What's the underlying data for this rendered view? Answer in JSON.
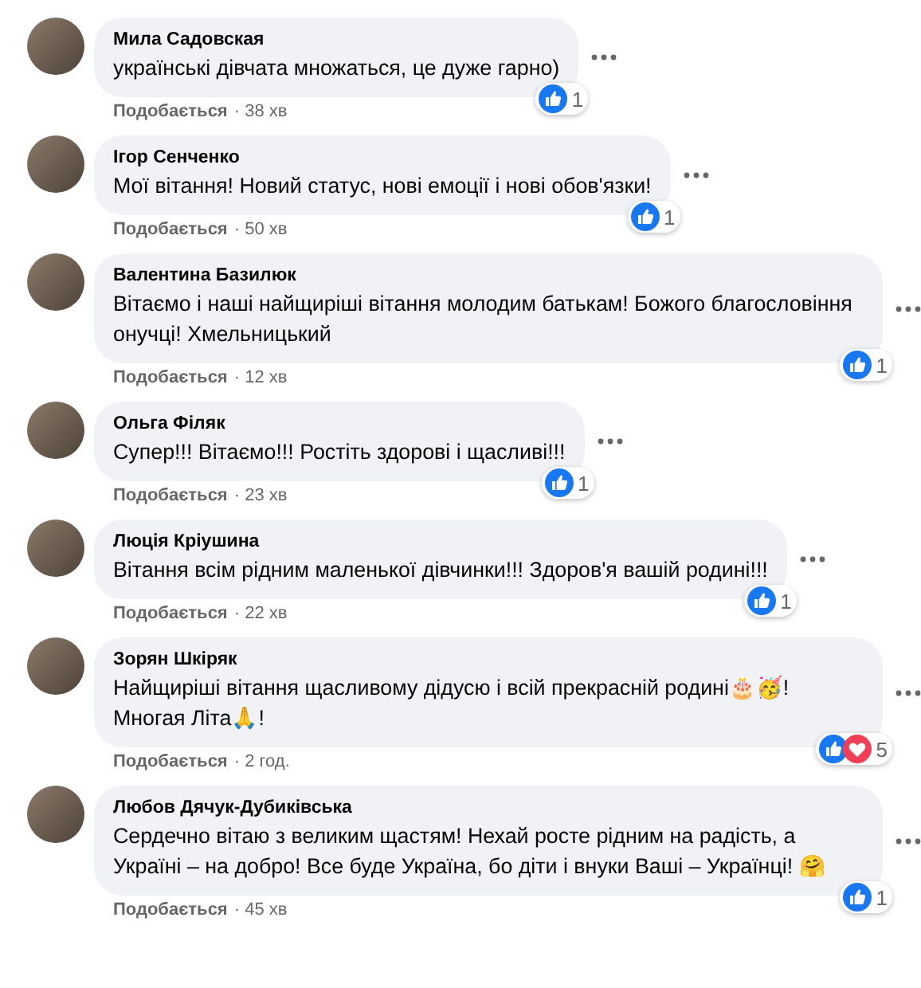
{
  "comments": [
    {
      "author": "Мила Садовская",
      "message": "українські дівчата множаться, це дуже гарно)",
      "reactions": [
        {
          "kind": "like"
        }
      ],
      "reaction_count": "1",
      "like_action": "Подобається",
      "time": "· 38 хв"
    },
    {
      "author": "Ігор Сенченко",
      "message": "Мої вітання! Новий статус, нові емоції і нові обов'язки!",
      "reactions": [
        {
          "kind": "like"
        }
      ],
      "reaction_count": "1",
      "like_action": "Подобається",
      "time": "· 50 хв"
    },
    {
      "author": "Валентина Базилюк",
      "message": "Вітаємо і наші найщиріші вітання молодим батькам! Божого благословіння онучці! Хмельницький",
      "reactions": [
        {
          "kind": "like"
        }
      ],
      "reaction_count": "1",
      "like_action": "Подобається",
      "time": "· 12 хв"
    },
    {
      "author": "Ольга Філяк",
      "message": "Супер!!! Вітаємо!!! Ростіть здорові і щасливі!!!",
      "reactions": [
        {
          "kind": "like"
        }
      ],
      "reaction_count": "1",
      "like_action": "Подобається",
      "time": "· 23 хв"
    },
    {
      "author": "Люція Кріушина",
      "message": "Вітання всім рідним маленької дівчинки!!! Здоров'я вашій родині!!!",
      "reactions": [
        {
          "kind": "like"
        }
      ],
      "reaction_count": "1",
      "like_action": "Подобається",
      "time": "· 22 хв"
    },
    {
      "author": "Зорян Шкіряк",
      "message": "Найщиріші вітання щасливому дідусю і всій прекрасній родині🎂🥳! Многая Літа🙏!",
      "reactions": [
        {
          "kind": "like"
        },
        {
          "kind": "love"
        }
      ],
      "reaction_count": "5",
      "like_action": "Подобається",
      "time": "· 2 год."
    },
    {
      "author": "Любов Дячук-Дубиківська",
      "message": "Сердечно вітаю з великим щастям! Нехай росте рідним на радість, а Україні – на добро! Все буде Україна, бо діти і внуки Ваші – Українці! 🤗",
      "reactions": [
        {
          "kind": "like"
        }
      ],
      "reaction_count": "1",
      "like_action": "Подобається",
      "time": "· 45 хв"
    }
  ]
}
